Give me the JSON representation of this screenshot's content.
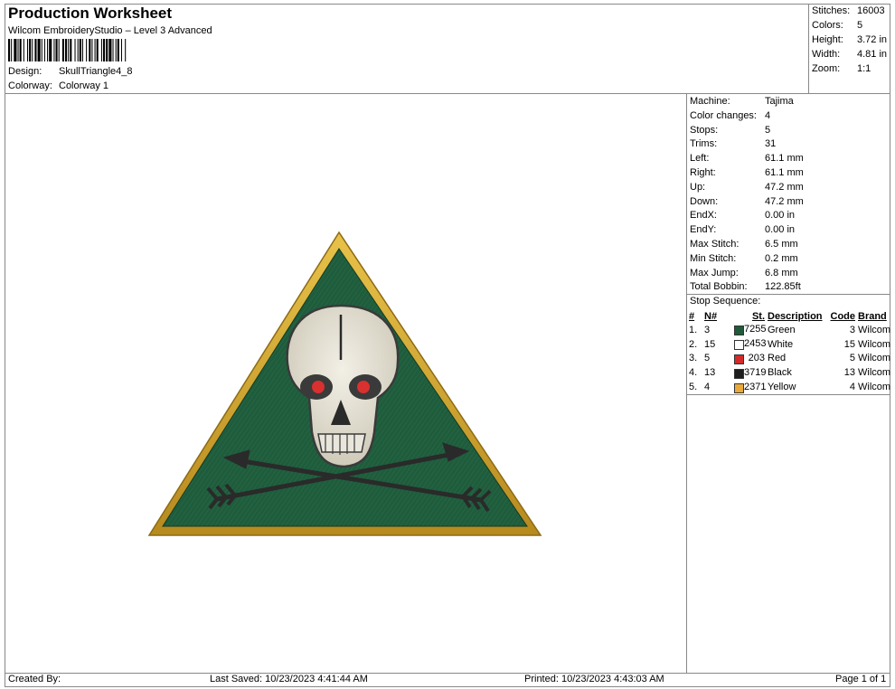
{
  "header": {
    "title": "Production Worksheet",
    "software": "Wilcom EmbroideryStudio – Level 3 Advanced",
    "design_label": "Design:",
    "design_value": "SkullTriangle4_8",
    "colorway_label": "Colorway:",
    "colorway_value": "Colorway 1"
  },
  "summary": {
    "stitches_label": "Stitches:",
    "stitches_value": "16003",
    "colors_label": "Colors:",
    "colors_value": "5",
    "height_label": "Height:",
    "height_value": "3.72 in",
    "width_label": "Width:",
    "width_value": "4.81 in",
    "zoom_label": "Zoom:",
    "zoom_value": "1:1"
  },
  "machine_info": [
    {
      "label": "Machine:",
      "value": "Tajima"
    },
    {
      "label": "Color changes:",
      "value": "4"
    },
    {
      "label": "Stops:",
      "value": "5"
    },
    {
      "label": "Trims:",
      "value": "31"
    },
    {
      "label": "Left:",
      "value": "61.1 mm"
    },
    {
      "label": "Right:",
      "value": "61.1 mm"
    },
    {
      "label": "Up:",
      "value": "47.2 mm"
    },
    {
      "label": "Down:",
      "value": "47.2 mm"
    },
    {
      "label": "EndX:",
      "value": "0.00 in"
    },
    {
      "label": "EndY:",
      "value": "0.00 in"
    },
    {
      "label": "Max Stitch:",
      "value": "6.5 mm"
    },
    {
      "label": "Min Stitch:",
      "value": "0.2 mm"
    },
    {
      "label": "Max Jump:",
      "value": "6.8 mm"
    },
    {
      "label": "Total Bobbin:",
      "value": "122.85ft"
    }
  ],
  "stop_sequence": {
    "title": "Stop Sequence:",
    "headers": {
      "num": "#",
      "n": "N#",
      "st": "St.",
      "description": "Description",
      "code": "Code",
      "brand": "Brand"
    },
    "rows": [
      {
        "num": "1.",
        "n": "3",
        "color": "#1f5a3a",
        "st": "7255",
        "description": "Green",
        "code": "3",
        "brand": "Wilcom"
      },
      {
        "num": "2.",
        "n": "15",
        "color": "#ffffff",
        "st": "2453",
        "description": "White",
        "code": "15",
        "brand": "Wilcom"
      },
      {
        "num": "3.",
        "n": "5",
        "color": "#d42a2a",
        "st": "203",
        "description": "Red",
        "code": "5",
        "brand": "Wilcom"
      },
      {
        "num": "4.",
        "n": "13",
        "color": "#1e1e1e",
        "st": "3719",
        "description": "Black",
        "code": "13",
        "brand": "Wilcom"
      },
      {
        "num": "5.",
        "n": "4",
        "color": "#e8a93a",
        "st": "2371",
        "description": "Yellow",
        "code": "4",
        "brand": "Wilcom"
      }
    ]
  },
  "footer": {
    "created_by": "Created By:",
    "last_saved": "Last Saved: 10/23/2023 4:41:44 AM",
    "printed": "Printed: 10/23/2023 4:43:03 AM",
    "page": "Page 1 of 1"
  },
  "design_colors": {
    "green": "#1e5c3c",
    "gold": "#d6a92c",
    "bone": "#e4e0d4",
    "dark": "#2a2a2a",
    "red": "#d93030"
  }
}
